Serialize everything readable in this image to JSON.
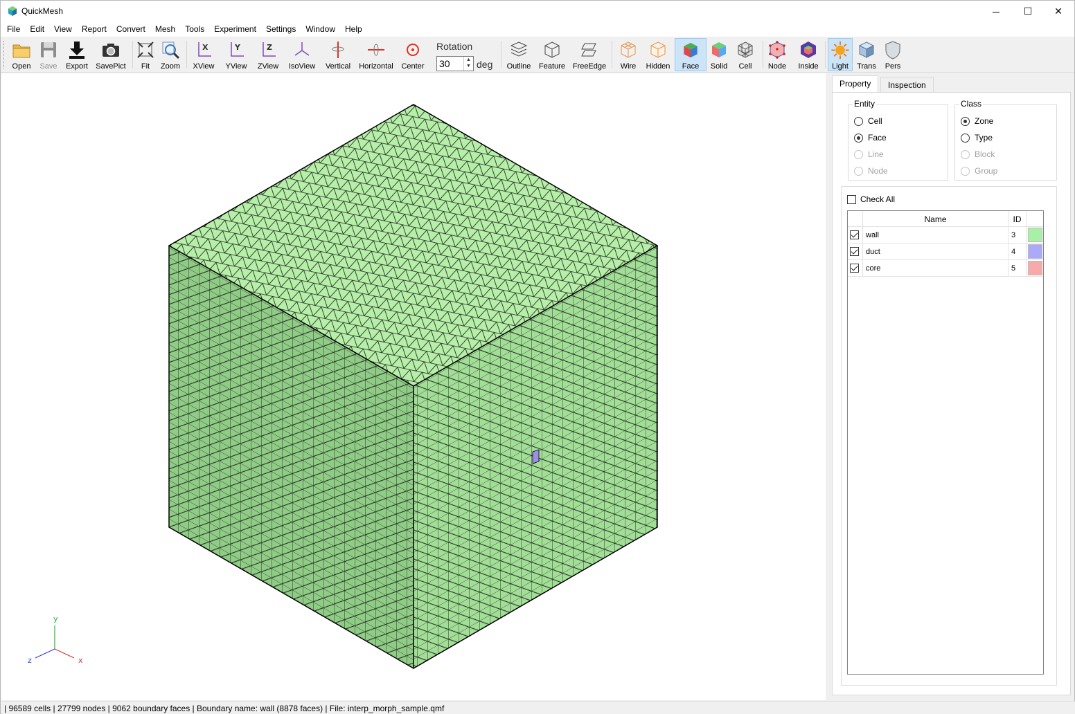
{
  "window": {
    "title": "QuickMesh",
    "minimize_glyph": "─",
    "maximize_glyph": "☐",
    "close_glyph": "✕"
  },
  "menu": [
    "File",
    "Edit",
    "View",
    "Report",
    "Convert",
    "Mesh",
    "Tools",
    "Experiment",
    "Settings",
    "Window",
    "Help"
  ],
  "toolbar": {
    "open": "Open",
    "save": "Save",
    "export": "Export",
    "savepict": "SavePict",
    "fit": "Fit",
    "zoom": "Zoom",
    "xview": "XView",
    "yview": "YView",
    "zview": "ZView",
    "isoview": "IsoView",
    "vertical": "Vertical",
    "horizontal": "Horizontal",
    "center": "Center",
    "rotation_label": "Rotation",
    "rotation_value": "30",
    "rotation_unit": "deg",
    "outline": "Outline",
    "feature": "Feature",
    "freeedge": "FreeEdge",
    "wire": "Wire",
    "hidden": "Hidden",
    "face": "Face",
    "solid": "Solid",
    "cell": "Cell",
    "node": "Node",
    "inside": "Inside",
    "light": "Light",
    "trans": "Trans",
    "pers": "Pers"
  },
  "viewport": {
    "mesh_color_top": "#b6f0a8",
    "mesh_color_left": "#8fcc85",
    "mesh_color_right": "#a2df96",
    "axis": {
      "y": "y",
      "z": "z",
      "x": "x"
    }
  },
  "panel": {
    "tabs": [
      "Property",
      "Inspection"
    ],
    "entity_title": "Entity",
    "entity_options": [
      "Cell",
      "Face",
      "Line",
      "Node"
    ],
    "class_title": "Class",
    "class_options": [
      "Zone",
      "Type",
      "Block",
      "Group"
    ],
    "check_all": "Check All",
    "table_headers": {
      "name": "Name",
      "id": "ID"
    },
    "rows": [
      {
        "name": "wall",
        "id": "3",
        "color": "#a8f0a8",
        "checked": true
      },
      {
        "name": "duct",
        "id": "4",
        "color": "#aaaaf8",
        "checked": true
      },
      {
        "name": "core",
        "id": "5",
        "color": "#f8aaaa",
        "checked": true
      }
    ]
  },
  "status": "| 96589 cells | 27799 nodes | 9062 boundary faces |  Boundary name: wall (8878 faces) | File: interp_morph_sample.qmf"
}
